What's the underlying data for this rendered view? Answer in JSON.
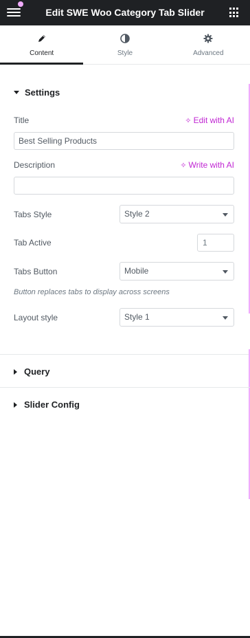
{
  "header": {
    "title": "Edit SWE Woo Category Tab Slider"
  },
  "tabs": [
    {
      "label": "Content",
      "icon": "pencil-icon",
      "active": true
    },
    {
      "label": "Style",
      "icon": "half-circle-icon",
      "active": false
    },
    {
      "label": "Advanced",
      "icon": "gear-icon",
      "active": false
    }
  ],
  "settings": {
    "heading": "Settings",
    "title_label": "Title",
    "title_ai": "Edit with AI",
    "title_value": "Best Selling Products",
    "description_label": "Description",
    "description_ai": "Write with AI",
    "description_value": "",
    "tabs_style_label": "Tabs Style",
    "tabs_style_value": "Style 2",
    "tab_active_label": "Tab Active",
    "tab_active_value": "1",
    "tabs_button_label": "Tabs Button",
    "tabs_button_value": "Mobile",
    "tabs_button_hint": "Button replaces tabs to display across screens",
    "layout_style_label": "Layout style",
    "layout_style_value": "Style 1"
  },
  "sections": {
    "query": "Query",
    "slider_config": "Slider Config"
  },
  "colors": {
    "ai_accent": "#c026d3",
    "topbar": "#1f2124",
    "notification_dot": "#f0abfc"
  }
}
